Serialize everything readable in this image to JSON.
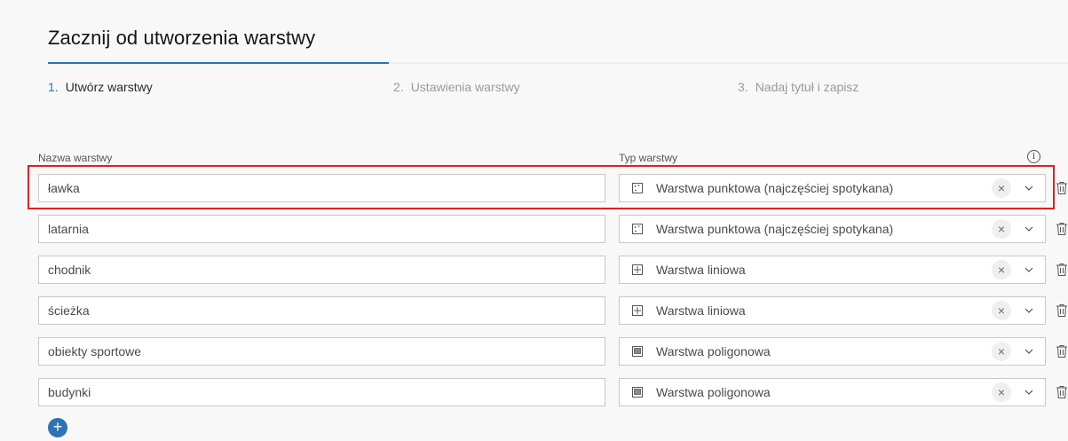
{
  "header": {
    "title": "Zacznij od utworzenia warstwy"
  },
  "steps": [
    {
      "number": "1.",
      "label": "Utwórz warstwy",
      "state": "active"
    },
    {
      "number": "2.",
      "label": "Ustawienia warstwy",
      "state": "inactive"
    },
    {
      "number": "3.",
      "label": "Nadaj tytuł i zapisz",
      "state": "inactive"
    }
  ],
  "progress": {
    "completed_fraction": 0.333
  },
  "columns": {
    "name_label": "Nazwa warstwy",
    "type_label": "Typ warstwy",
    "info_icon": "i"
  },
  "layers": [
    {
      "name": "ławka",
      "type": "Warstwa punktowa (najczęściej spotykana)",
      "type_icon": "point-layer-icon"
    },
    {
      "name": "latarnia",
      "type": "Warstwa punktowa (najczęściej spotykana)",
      "type_icon": "point-layer-icon"
    },
    {
      "name": "chodnik",
      "type": "Warstwa liniowa",
      "type_icon": "line-layer-icon"
    },
    {
      "name": "ścieżka",
      "type": "Warstwa liniowa",
      "type_icon": "line-layer-icon"
    },
    {
      "name": "obiekty sportowe",
      "type": "Warstwa poligonowa",
      "type_icon": "polygon-layer-icon"
    },
    {
      "name": "budynki",
      "type": "Warstwa poligonowa",
      "type_icon": "polygon-layer-icon"
    }
  ],
  "controls": {
    "clear_symbol": "×",
    "add_symbol": "+"
  },
  "colors": {
    "accent": "#2b73b4",
    "highlight": "#e02020",
    "background": "#f8f8f8"
  }
}
